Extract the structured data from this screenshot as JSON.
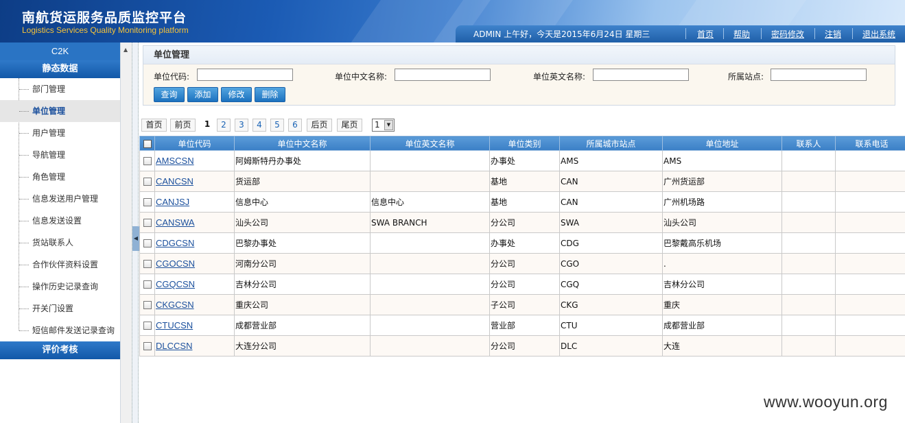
{
  "header": {
    "title_cn": "南航货运服务品质监控平台",
    "title_en": "Logistics Services Quality Monitoring platform",
    "welcome": "ADMIN 上午好，今天是2015年6月24日 星期三",
    "nav": [
      "首页",
      "帮助",
      "密码修改",
      "注销",
      "退出系统"
    ]
  },
  "sidebar": {
    "c2k": "C2K",
    "section_static": "静态数据",
    "items": [
      "部门管理",
      "单位管理",
      "用户管理",
      "导航管理",
      "角色管理",
      "信息发送用户管理",
      "信息发送设置",
      "货站联系人",
      "合作伙伴资料设置",
      "操作历史记录查询",
      "开关门设置",
      "短信邮件发送记录查询"
    ],
    "active_item": "单位管理",
    "section_eval": "评价考核"
  },
  "filter": {
    "title": "单位管理",
    "labels": [
      "单位代码:",
      "单位中文名称:",
      "单位英文名称:",
      "所属站点:"
    ],
    "values": [
      "",
      "",
      "",
      ""
    ],
    "buttons": [
      "查询",
      "添加",
      "修改",
      "删除"
    ]
  },
  "pager": {
    "first": "首页",
    "prev": "前页",
    "pages": [
      "1",
      "2",
      "3",
      "4",
      "5",
      "6"
    ],
    "current": "1",
    "next": "后页",
    "last": "尾页",
    "select_value": "1"
  },
  "table": {
    "headers": [
      "单位代码",
      "单位中文名称",
      "单位英文名称",
      "单位类别",
      "所属城市站点",
      "单位地址",
      "联系人",
      "联系电话"
    ],
    "rows": [
      [
        "AMSCSN",
        "阿姆斯特丹办事处",
        "",
        "办事处",
        "AMS",
        "AMS",
        "",
        ""
      ],
      [
        "CANCSN",
        "货运部",
        "",
        "基地",
        "CAN",
        "广州货运部",
        "",
        ""
      ],
      [
        "CANJSJ",
        "信息中心",
        "信息中心",
        "基地",
        "CAN",
        "广州机场路",
        "",
        ""
      ],
      [
        "CANSWA",
        "汕头公司",
        "SWA BRANCH",
        "分公司",
        "SWA",
        "汕头公司",
        "",
        ""
      ],
      [
        "CDGCSN",
        "巴黎办事处",
        "",
        "办事处",
        "CDG",
        "巴黎戴高乐机场",
        "",
        ""
      ],
      [
        "CGOCSN",
        "河南分公司",
        "",
        "分公司",
        "CGO",
        ".",
        "",
        ""
      ],
      [
        "CGQCSN",
        "吉林分公司",
        "",
        "分公司",
        "CGQ",
        "吉林分公司",
        "",
        ""
      ],
      [
        "CKGCSN",
        "重庆公司",
        "",
        "子公司",
        "CKG",
        "重庆",
        "",
        ""
      ],
      [
        "CTUCSN",
        "成都营业部",
        "",
        "营业部",
        "CTU",
        "成都营业部",
        "",
        ""
      ],
      [
        "DLCCSN",
        "大连分公司",
        "",
        "分公司",
        "DLC",
        "大连",
        "",
        ""
      ]
    ]
  },
  "watermark": "www.wooyun.org"
}
